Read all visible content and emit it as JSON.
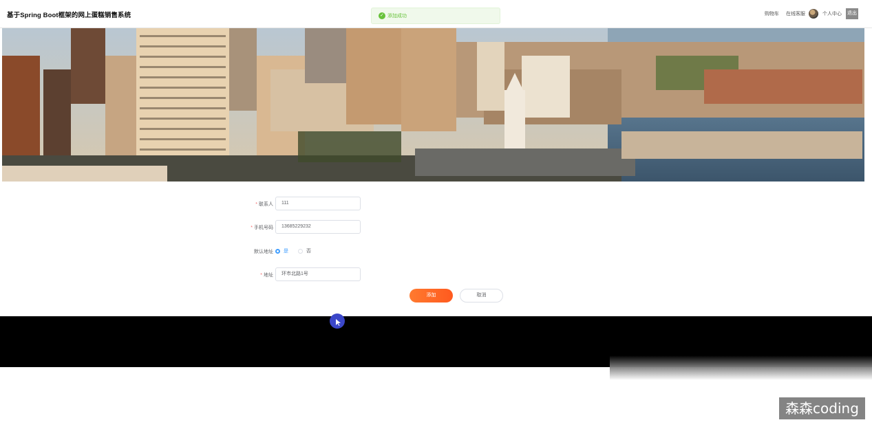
{
  "header": {
    "site_title": "基于Spring Boot框架的网上蛋糕销售系统",
    "toast": {
      "icon": "check-circle-icon",
      "text": "添加成功",
      "color": "#67c23a"
    },
    "nav": {
      "cart": "购物车",
      "online_service": "在线客服",
      "profile": "个人中心",
      "logout": "退出"
    }
  },
  "banner": {
    "description_icon": "city-skyline-image"
  },
  "form": {
    "contact": {
      "label": "联系人",
      "value": "111",
      "required": true
    },
    "phone": {
      "label": "手机号码",
      "value": "13685229232",
      "required": true
    },
    "default_address": {
      "label": "默认地址",
      "options": [
        "是",
        "否"
      ],
      "selected": "是"
    },
    "address": {
      "label": "地址",
      "value": "环市北路1号",
      "required": true
    },
    "submit_label": "添加",
    "cancel_label": "取消"
  },
  "watermark": {
    "text": "森森coding"
  },
  "colors": {
    "accent": "#409eff",
    "primary_button": "#ff6a2a",
    "success": "#67c23a"
  }
}
